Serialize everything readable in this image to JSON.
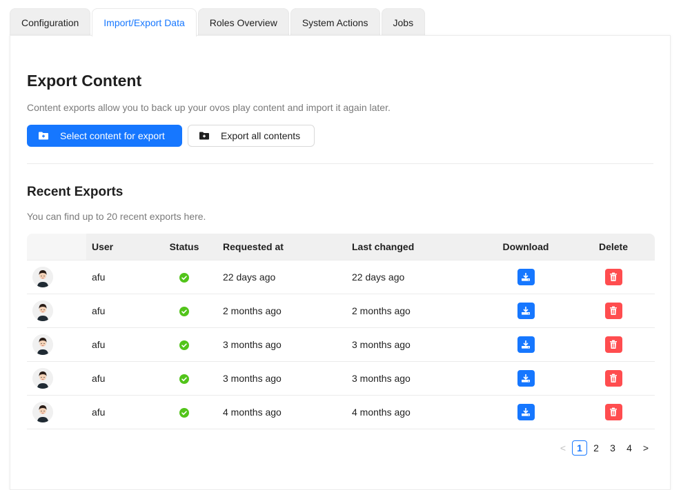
{
  "tabs": [
    {
      "label": "Configuration",
      "active": false
    },
    {
      "label": "Import/Export Data",
      "active": true
    },
    {
      "label": "Roles Overview",
      "active": false
    },
    {
      "label": "System Actions",
      "active": false
    },
    {
      "label": "Jobs",
      "active": false
    }
  ],
  "export": {
    "title": "Export Content",
    "description": "Content exports allow you to back up your ovos play content and import it again later.",
    "select_button": "Select content for export",
    "export_all_button": "Export all contents",
    "button_icon": "folder-add-icon"
  },
  "recent": {
    "title": "Recent Exports",
    "description": "You can find up to 20 recent exports here.",
    "columns": [
      "",
      "User",
      "Status",
      "Requested at",
      "Last changed",
      "Download",
      "Delete"
    ],
    "rows": [
      {
        "user": "afu",
        "status": "success",
        "requested": "22 days ago",
        "changed": "22 days ago"
      },
      {
        "user": "afu",
        "status": "success",
        "requested": "2 months ago",
        "changed": "2 months ago"
      },
      {
        "user": "afu",
        "status": "success",
        "requested": "3 months ago",
        "changed": "3 months ago"
      },
      {
        "user": "afu",
        "status": "success",
        "requested": "3 months ago",
        "changed": "3 months ago"
      },
      {
        "user": "afu",
        "status": "success",
        "requested": "4 months ago",
        "changed": "4 months ago"
      }
    ]
  },
  "pagination": {
    "prev": "<",
    "next": ">",
    "pages": [
      "1",
      "2",
      "3",
      "4"
    ],
    "current": "1"
  },
  "colors": {
    "primary": "#1677ff",
    "danger": "#ff4d4f",
    "success": "#52c41a"
  }
}
